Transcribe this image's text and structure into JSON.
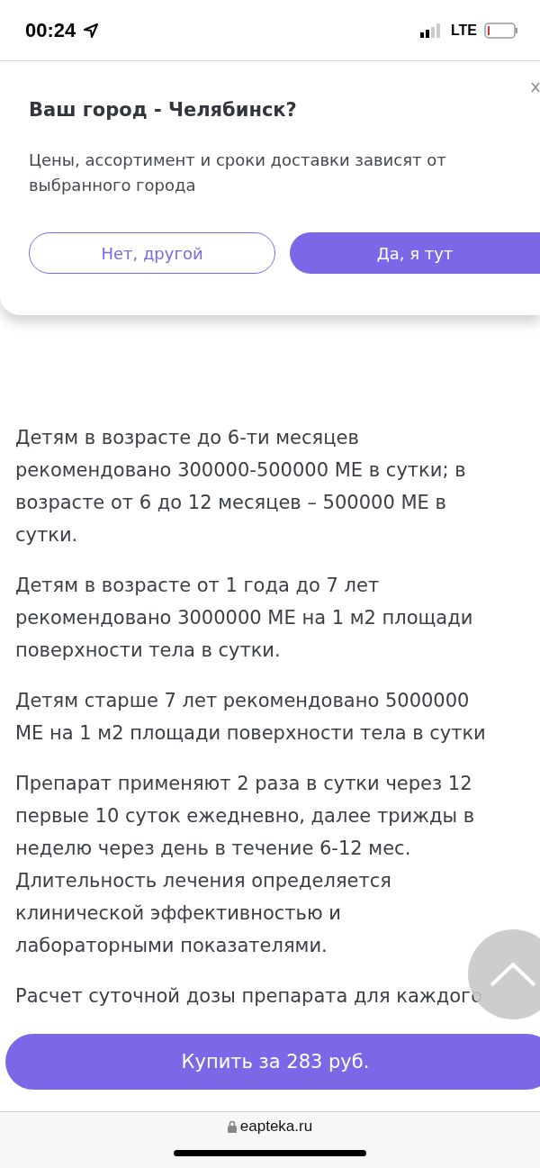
{
  "status_bar": {
    "time": "00:24",
    "network": "LTE"
  },
  "city_popup": {
    "title": "Ваш город - Челябинск?",
    "text_lines": [
      "Цены, ассортимент и сроки доставки зависят от",
      "выбранного города"
    ],
    "buttons": [
      {
        "label": "Нет, другой",
        "kind": "outline"
      },
      {
        "label": "Да, я тут",
        "kind": "primary"
      }
    ]
  },
  "paragraphs": [
    {
      "lines": [
        "Детям в возрасте до 6-ти месяцев",
        "рекомендовано 300000-500000 МЕ в сутки; в",
        "возрасте от 6 до 12 месяцев – 500000 МЕ в",
        "сутки."
      ]
    },
    {
      "lines": [
        "Детям в возрасте от 1 года до 7 лет",
        "рекомендовано 3000000 МЕ на 1 м2 площади",
        "поверхности тела в сутки."
      ]
    },
    {
      "lines": [
        "Детям старше 7 лет рекомендовано 5000000",
        "МЕ на 1 м2 площади поверхности тела в сутки"
      ]
    },
    {
      "lines": [
        "Препарат применяют 2 раза в сутки через 12",
        "первые 10 суток ежедневно, далее трижды в",
        "неделю через день в течение 6-12 мес.",
        "Длительность лечения определяется",
        "клинической эффективностью и",
        "лабораторными показателями."
      ]
    },
    {
      "lines": [
        "Расчет суточной дозы препарата для каждого"
      ]
    }
  ],
  "buy_button": {
    "label": "Купить за 283 руб."
  },
  "browser_bar": {
    "url": "eapteka.ru"
  }
}
